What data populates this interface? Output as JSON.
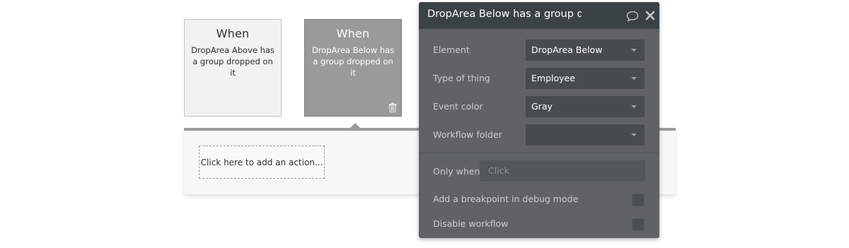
{
  "events": {
    "above": {
      "heading": "When",
      "description": "DropArea Above has a group dropped on it"
    },
    "below": {
      "heading": "When",
      "description": "DropArea Below has a group dropped on it"
    }
  },
  "actions": {
    "add_action_label": "Click here to add an action..."
  },
  "editor": {
    "title": "DropArea Below has a group dropped on it",
    "fields": {
      "element": {
        "label": "Element",
        "value": "DropArea Below"
      },
      "type_of_thing": {
        "label": "Type of thing",
        "value": "Employee"
      },
      "event_color": {
        "label": "Event color",
        "value": "Gray"
      },
      "workflow_folder": {
        "label": "Workflow folder",
        "value": ""
      }
    },
    "only_when": {
      "label": "Only when",
      "placeholder": "Click"
    },
    "breakpoint": {
      "label": "Add a breakpoint in debug mode"
    },
    "disable": {
      "label": "Disable workflow"
    }
  },
  "colors": {
    "selected_card": "#9a9a9a",
    "editor_background": "#5f6366",
    "editor_header": "#3b4245"
  },
  "icons": [
    "trash-icon",
    "comment-icon",
    "close-icon",
    "chevron-down-icon"
  ]
}
